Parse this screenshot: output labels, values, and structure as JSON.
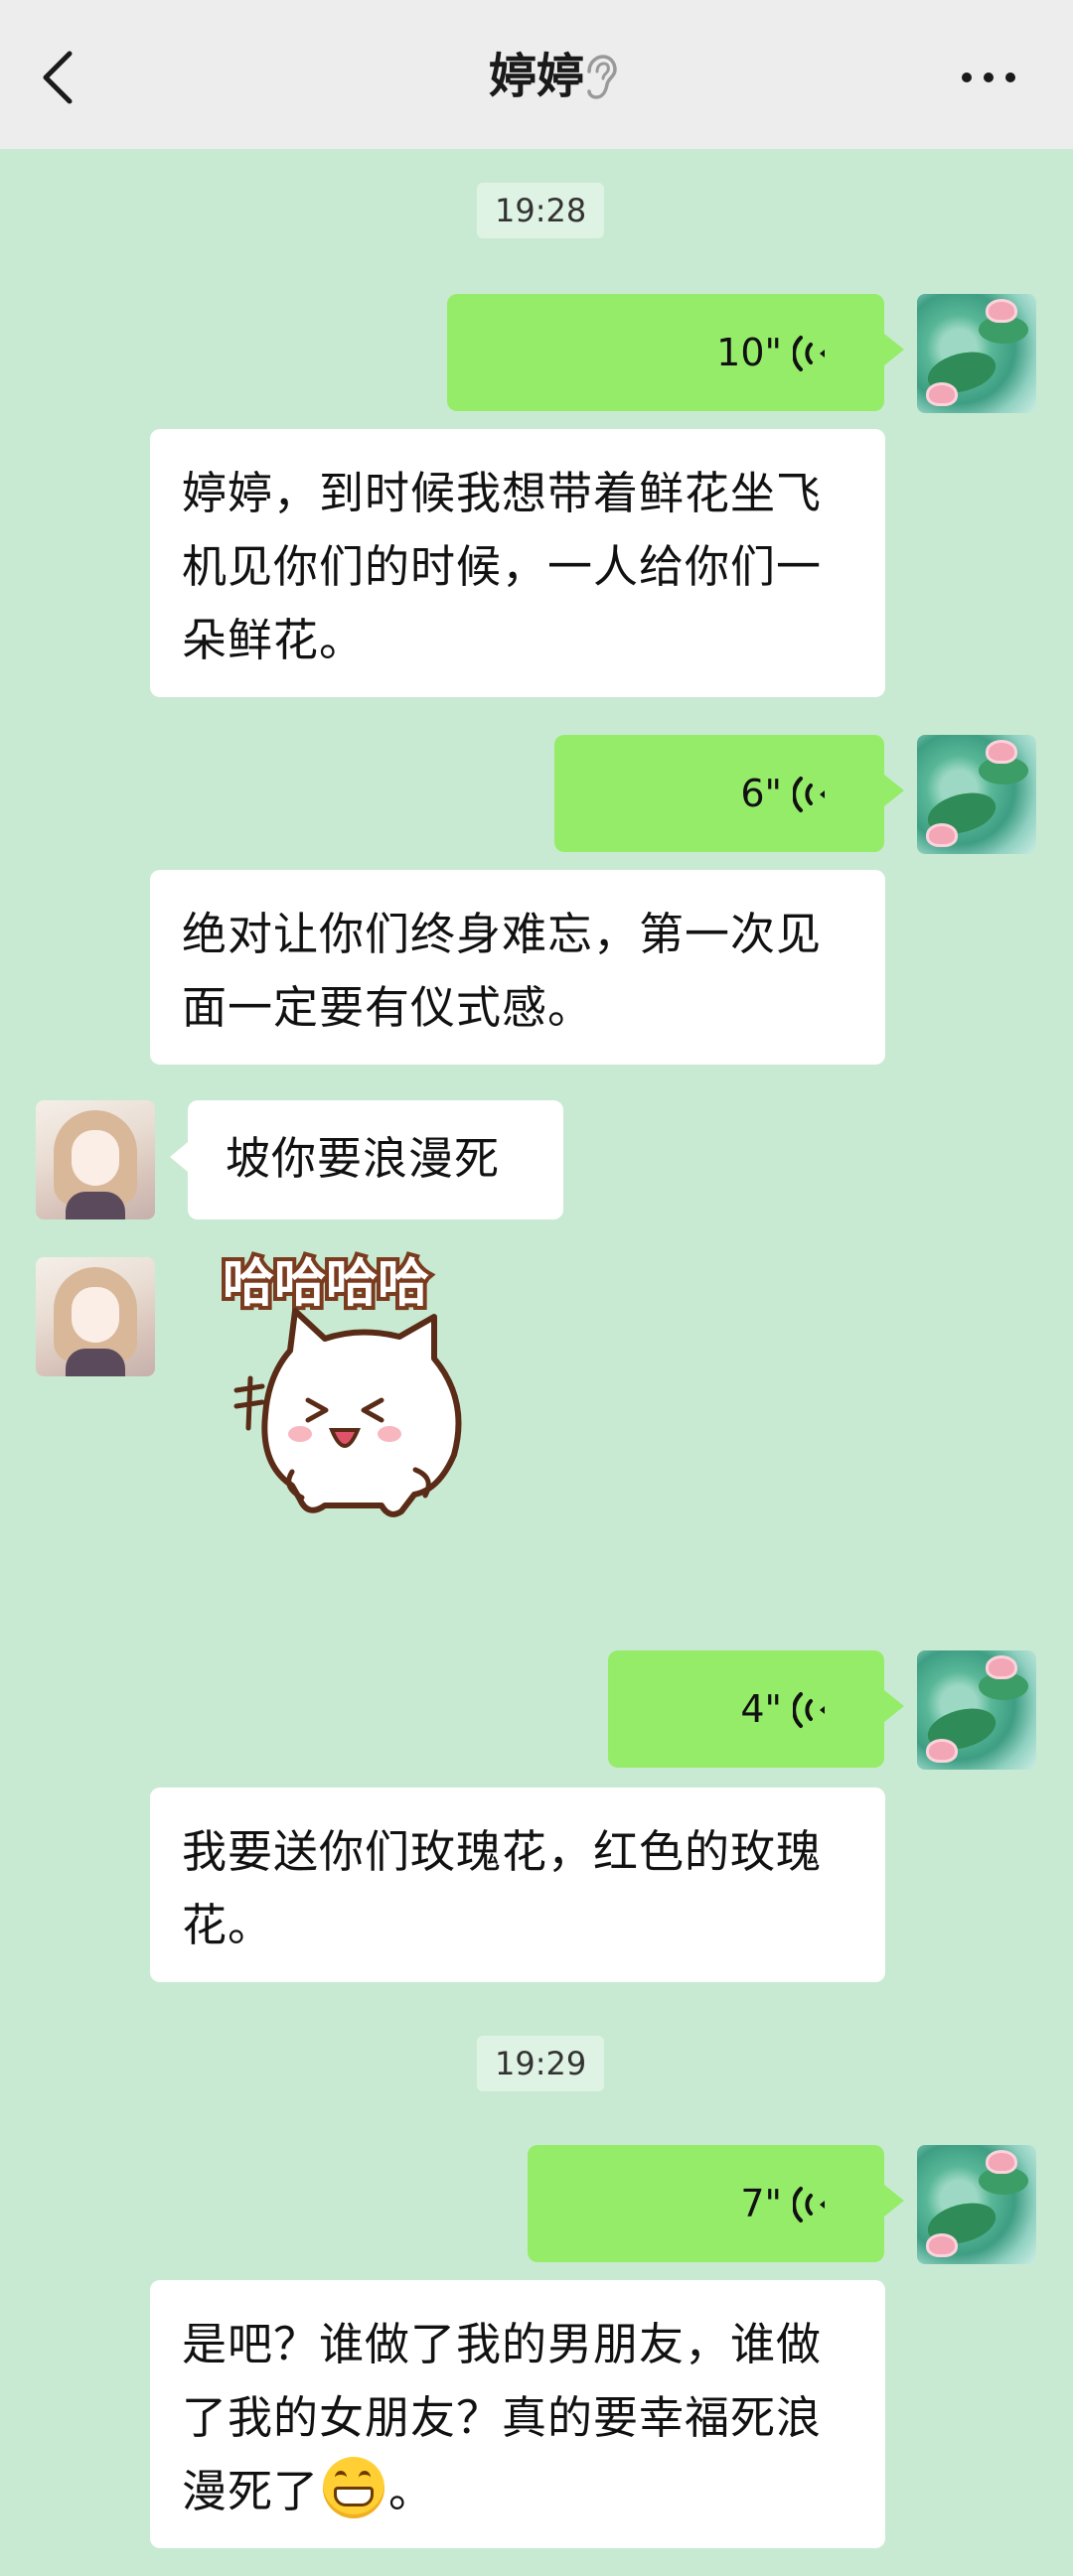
{
  "header": {
    "title": "婷婷",
    "back_icon": "chevron-left-icon",
    "ear_icon": "ear-icon",
    "more_icon": "more-dots-icon"
  },
  "messages": {
    "time1": "19:28",
    "voice1_duration": "10\"",
    "text1": "婷婷，到时候我想带着鲜花坐飞机见你们的时候，一人给你们一朵鲜花。",
    "voice2_duration": "6\"",
    "text2": "绝对让你们终身难忘，第一次见面一定要有仪式感。",
    "reply1": "坡你要浪漫死",
    "sticker_text": "哈哈哈哈",
    "voice3_duration": "4\"",
    "text3": "我要送你们玫瑰花，红色的玫瑰花。",
    "time2": "19:29",
    "voice4_duration": "7\"",
    "text4_part1": "是吧？谁做了我的男朋友，谁做了我的女朋友？真的要幸福死浪漫死了",
    "text4_part2": "。"
  },
  "colors": {
    "background": "#c9ead2",
    "voice_bubble": "#95ec69",
    "text_bubble": "#ffffff",
    "topbar": "#ededed"
  }
}
